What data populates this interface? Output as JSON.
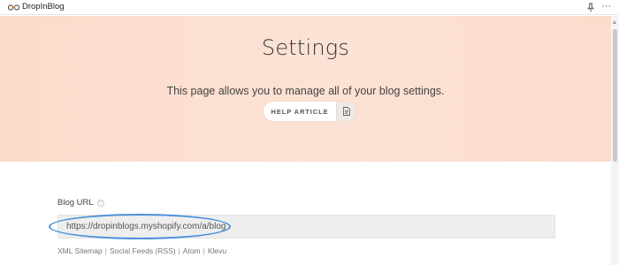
{
  "app": {
    "title": "DropInBlog",
    "logo_icon": "dropinblog-logo-icon",
    "pin_icon": "pin-icon",
    "more_label": "···"
  },
  "hero": {
    "title": "Settings",
    "description": "This page allows you to manage all of your blog settings.",
    "help_button_label": "HELP ARTICLE",
    "help_icon": "document-icon"
  },
  "form": {
    "blog_url_label": "Blog URL",
    "blog_url_value": "https://dropinblogs.myshopify.com/a/blog",
    "help_icon_glyph": "?",
    "links": [
      {
        "label": "XML Sitemap"
      },
      {
        "label": "Social Feeds (RSS)"
      },
      {
        "label": "Atom"
      },
      {
        "label": "Klevu"
      }
    ],
    "separator": "|"
  },
  "colors": {
    "hero_bg": "#fce0d1",
    "annotation": "#4a90d9",
    "field_bg": "#eeeeee"
  }
}
